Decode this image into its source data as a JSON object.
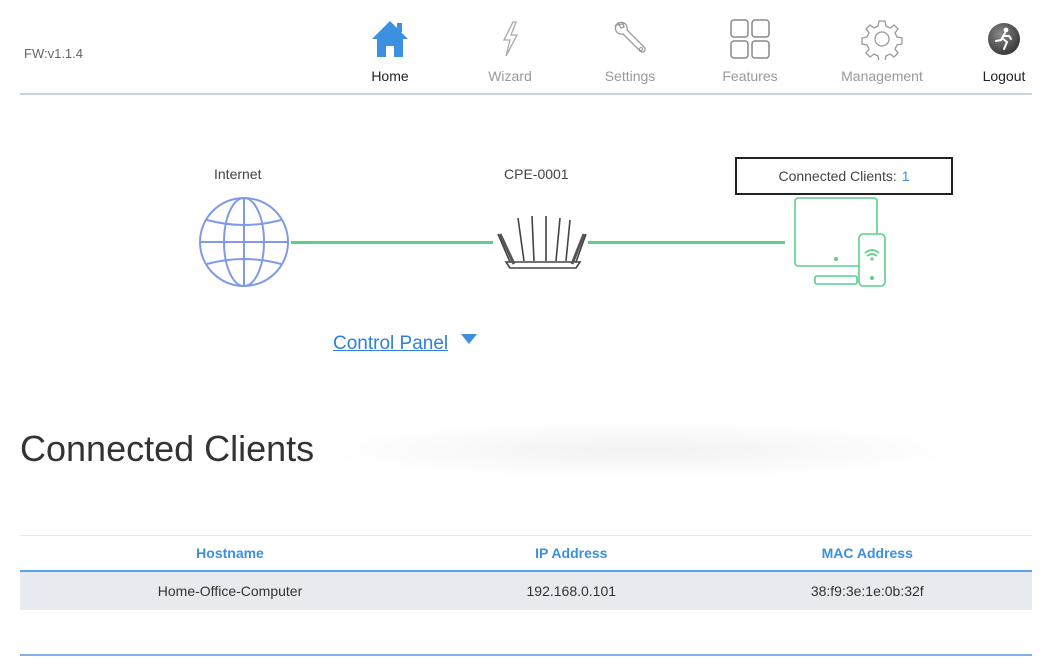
{
  "firmware": "FW:v1.1.4",
  "nav": {
    "home": "Home",
    "wizard": "Wizard",
    "settings": "Settings",
    "features": "Features",
    "management": "Management",
    "logout": "Logout"
  },
  "topology": {
    "internet_label": "Internet",
    "device_label": "CPE-0001",
    "clients_label": "Connected Clients:",
    "clients_count": "1"
  },
  "control_panel": "Control Panel",
  "section_title": "Connected Clients",
  "table": {
    "headers": [
      "Hostname",
      "IP Address",
      "MAC Address"
    ],
    "rows": [
      [
        "Home-Office-Computer",
        "192.168.0.101",
        "38:f9:3e:1e:0b:32f"
      ]
    ]
  },
  "colors": {
    "accent": "#3d8fe0",
    "link_line": "#5ad08a",
    "globe": "#7f9be6"
  }
}
